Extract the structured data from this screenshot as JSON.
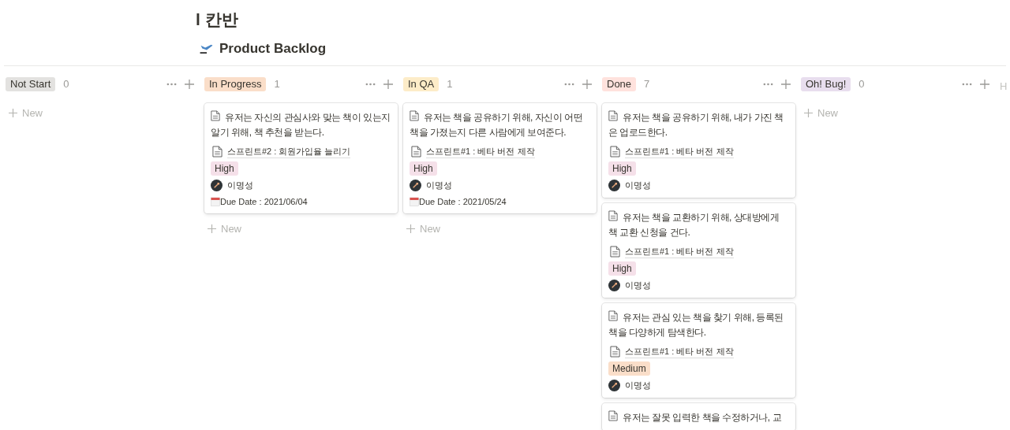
{
  "page": {
    "title": "l 칸반",
    "view_title": "Product Backlog"
  },
  "columns": [
    {
      "label": "Not Start",
      "count": "0",
      "color": "#e3e2e0",
      "new_label": "New"
    },
    {
      "label": "In Progress",
      "count": "1",
      "color": "#fadec9",
      "new_label": "New",
      "cards": [
        {
          "title": "유저는 자신의 관심사와 맞는 책이 있는지 알기 위해, 책 추천을 받는다.",
          "sprint": "스프린트#2 : 회원가입율 늘리기",
          "priority": {
            "label": "High",
            "color": "#f5e0e9"
          },
          "assignee": "이명성",
          "due": "Due Date : 2021/06/04"
        }
      ]
    },
    {
      "label": "In QA",
      "count": "1",
      "color": "#fdecc8",
      "new_label": "New",
      "cards": [
        {
          "title": "유저는 책을 공유하기 위해, 자신이 어떤 책을 가졌는지 다른 사람에게 보여준다.",
          "sprint": "스프린트#1 : 베타 버전 제작",
          "priority": {
            "label": "High",
            "color": "#f5e0e9"
          },
          "assignee": "이명성",
          "due": "Due Date : 2021/05/24"
        }
      ]
    },
    {
      "label": "Done",
      "count": "7",
      "color": "#ffe2dd",
      "cards": [
        {
          "title": "유저는 책을 공유하기 위해, 내가 가진 책은 업로드한다.",
          "sprint": "스프린트#1 : 베타 버전 제작",
          "priority": {
            "label": "High",
            "color": "#f5e0e9"
          },
          "assignee": "이명성"
        },
        {
          "title": "유저는 책을 교환하기 위해, 상대방에게 책 교환 신청을 건다.",
          "sprint": "스프린트#1 : 베타 버전 제작",
          "priority": {
            "label": "High",
            "color": "#f5e0e9"
          },
          "assignee": "이명성"
        },
        {
          "title": "유저는 관심 있는 책을 찾기 위해, 등록된 책을 다양하게 탐색한다.",
          "sprint": "스프린트#1 : 베타 버전 제작",
          "priority": {
            "label": "Medium",
            "color": "#fadec9"
          },
          "assignee": "이명성"
        },
        {
          "title": "유저는 잘못 입력한 책을 수정하거나, 교"
        }
      ]
    },
    {
      "label": "Oh! Bug!",
      "count": "0",
      "color": "#e8deee",
      "new_label": "New"
    }
  ],
  "hidden_column_label": "H"
}
